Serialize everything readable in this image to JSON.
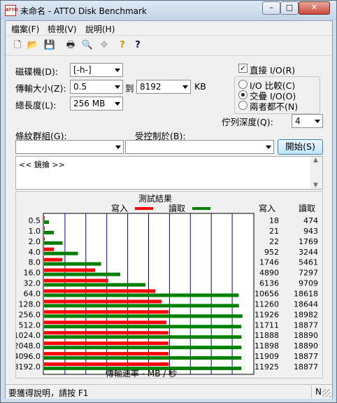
{
  "window": {
    "title": "未命名 - ATTO Disk Benchmark",
    "icon_text": "ATTO"
  },
  "title_buttons": {
    "minimize": "–",
    "maximize": "□",
    "close": "✕"
  },
  "menu": [
    "檔案(F)",
    "檢視(V)",
    "說明(H)"
  ],
  "toolbar_icons": [
    "new-file-icon",
    "open-folder-icon",
    "save-icon",
    "print-icon",
    "print-preview-icon",
    "move-icon",
    "help-icon",
    "context-help-icon"
  ],
  "toolbar_glyphs": [
    "🗋",
    "📂",
    "💾",
    "🖶",
    "🔍",
    "✥",
    "?",
    "?"
  ],
  "form": {
    "drive_label": "磁碟機(D):",
    "drive_value": "[-h-]",
    "transfer_label": "傳輸大小(Z):",
    "transfer_from": "0.5",
    "to_label": "到",
    "transfer_to": "8192",
    "kb_label": "KB",
    "length_label": "總長度(L):",
    "length_value": "256 MB",
    "direct_io_label": "直接 I/O(R)",
    "direct_io_checked": true,
    "io_compare_label": "I/O 比較(C)",
    "overlapped_io_label": "交疊 I/O(O)",
    "neither_label": "兩者都不(N)",
    "selected_mode": "overlapped",
    "queue_label": "佇列深度(Q):",
    "queue_value": "4",
    "group_label": "條紋群組(G):",
    "group_value": "",
    "controlled_label": "受控制於(B):",
    "controlled_value": "",
    "start_button": "開始(S)"
  },
  "description_text": "<< 鏡掄 >>",
  "status_text": "要獲得說明，請按 F1",
  "status_indicator": "N",
  "chart_data": {
    "type": "bar",
    "title": "測試結果",
    "legend": [
      {
        "name": "寫入",
        "color": "#ff0000"
      },
      {
        "name": "讀取",
        "color": "#008000"
      }
    ],
    "xlabel": "傳輸速率 - MB / 秒",
    "xlim": [
      0,
      20
    ],
    "xticks": [
      0,
      2,
      4,
      6,
      8,
      10,
      12,
      14,
      16,
      18,
      20
    ],
    "grid": true,
    "categories": [
      "0.5",
      "1.0",
      "2.0",
      "4.0",
      "8.0",
      "16.0",
      "32.0",
      "64.0",
      "128.0",
      "256.0",
      "512.0",
      "1024.0",
      "2048.0",
      "4096.0",
      "8192.0"
    ],
    "table_headers": {
      "write": "寫入",
      "read": "讀取"
    },
    "series": [
      {
        "name": "寫入",
        "color": "#ff0000",
        "values": [
          18,
          21,
          22,
          952,
          1746,
          4890,
          6136,
          10656,
          11260,
          11926,
          11711,
          11888,
          11898,
          11909,
          11925
        ]
      },
      {
        "name": "讀取",
        "color": "#008000",
        "values": [
          474,
          943,
          1769,
          3244,
          5461,
          7297,
          9709,
          18618,
          18644,
          18982,
          18877,
          18890,
          18890,
          18877,
          18877
        ]
      }
    ]
  }
}
